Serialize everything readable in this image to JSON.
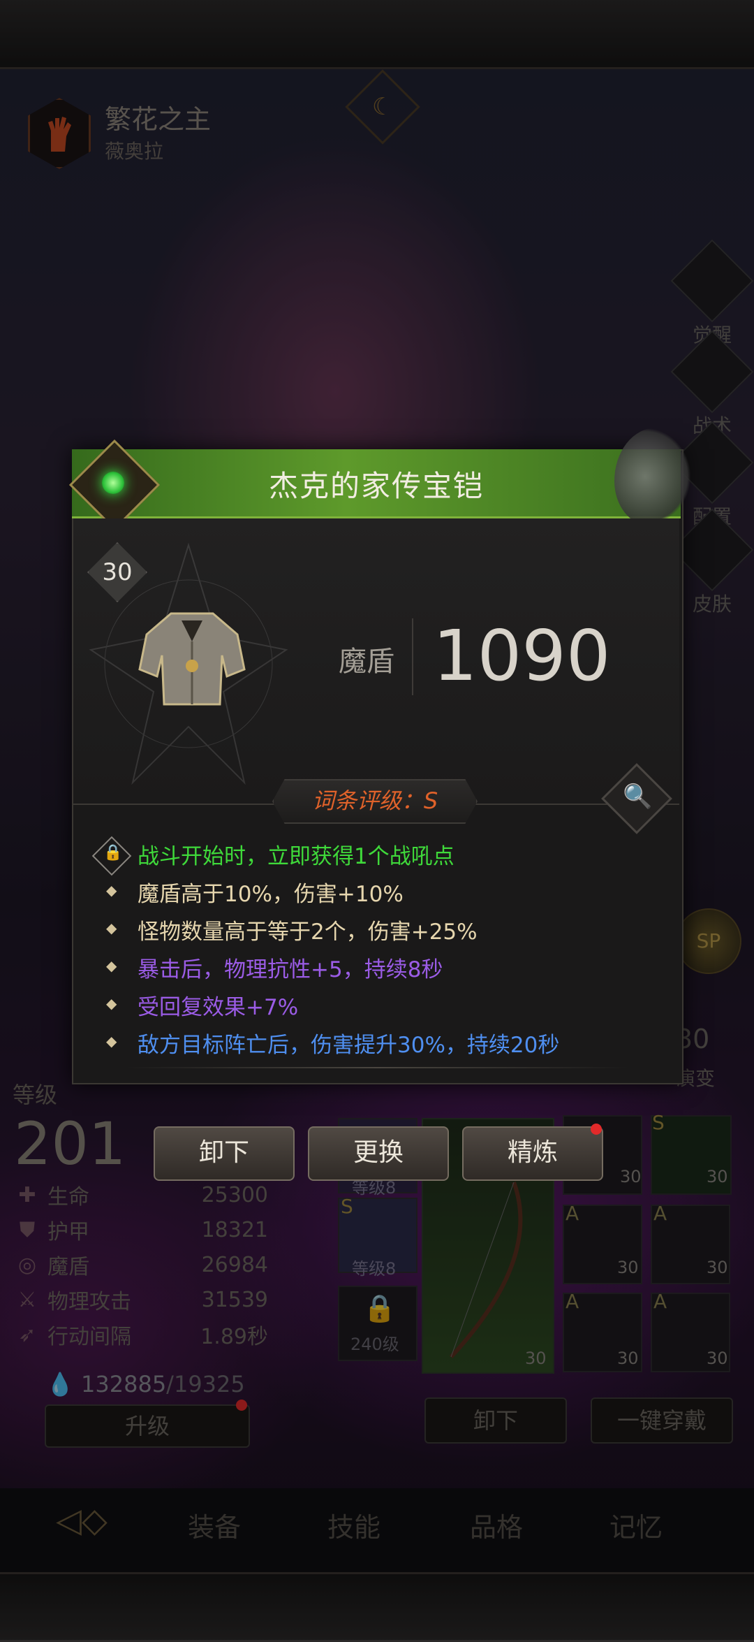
{
  "hero": {
    "name": "繁花之主",
    "subtitle": "薇奥拉"
  },
  "side_menu": [
    "觉醒",
    "战术",
    "配置",
    "皮肤"
  ],
  "stats": {
    "level_label": "等级",
    "level": "201",
    "rows": [
      {
        "label": "生命",
        "value": "25300",
        "icon": "heart-icon"
      },
      {
        "label": "护甲",
        "value": "18321",
        "icon": "shield-icon"
      },
      {
        "label": "魔盾",
        "value": "26984",
        "icon": "swirl-icon"
      },
      {
        "label": "物理攻击",
        "value": "31539",
        "icon": "sword-icon"
      },
      {
        "label": "行动间隔",
        "value": "1.89秒",
        "icon": "wing-icon"
      }
    ],
    "mana_current": "132885",
    "mana_needed": "/19325",
    "upgrade_label": "升级"
  },
  "equipment": {
    "slot_labels": [
      "等级8",
      "等级8",
      "240级"
    ],
    "grade_s": "S",
    "grade_a": "A",
    "item_level": "30",
    "unequip_label": "卸下",
    "equip_all_label": "一键穿戴",
    "side_counter": "30",
    "side_counter_label": "演变",
    "sp_label": "SP"
  },
  "nav": {
    "tabs": [
      "装备",
      "技能",
      "品格",
      "记忆"
    ]
  },
  "modal": {
    "title": "杰克的家传宝铠",
    "level": "30",
    "stat_name": "魔盾",
    "stat_value": "1090",
    "rating": "词条评级：S",
    "affixes": [
      {
        "text": "战斗开始时，立即获得1个战吼点",
        "color": "#3fd93a"
      },
      {
        "text": "魔盾高于10%，伤害+10%",
        "color": "#e6d6ae"
      },
      {
        "text": "怪物数量高于等于2个，伤害+25%",
        "color": "#e6d6ae"
      },
      {
        "text": "暴击后，物理抗性+5，持续8秒",
        "color": "#9b5ce6"
      },
      {
        "text": "受回复效果+7%",
        "color": "#9b5ce6"
      },
      {
        "text": "敌方目标阵亡后，伤害提升30%，持续20秒",
        "color": "#4f8ff0"
      }
    ],
    "buttons": {
      "unequip": "卸下",
      "replace": "更换",
      "refine": "精炼"
    },
    "colors": {
      "title_bar": "#5e9a2b",
      "rating": "#e0622a"
    }
  }
}
